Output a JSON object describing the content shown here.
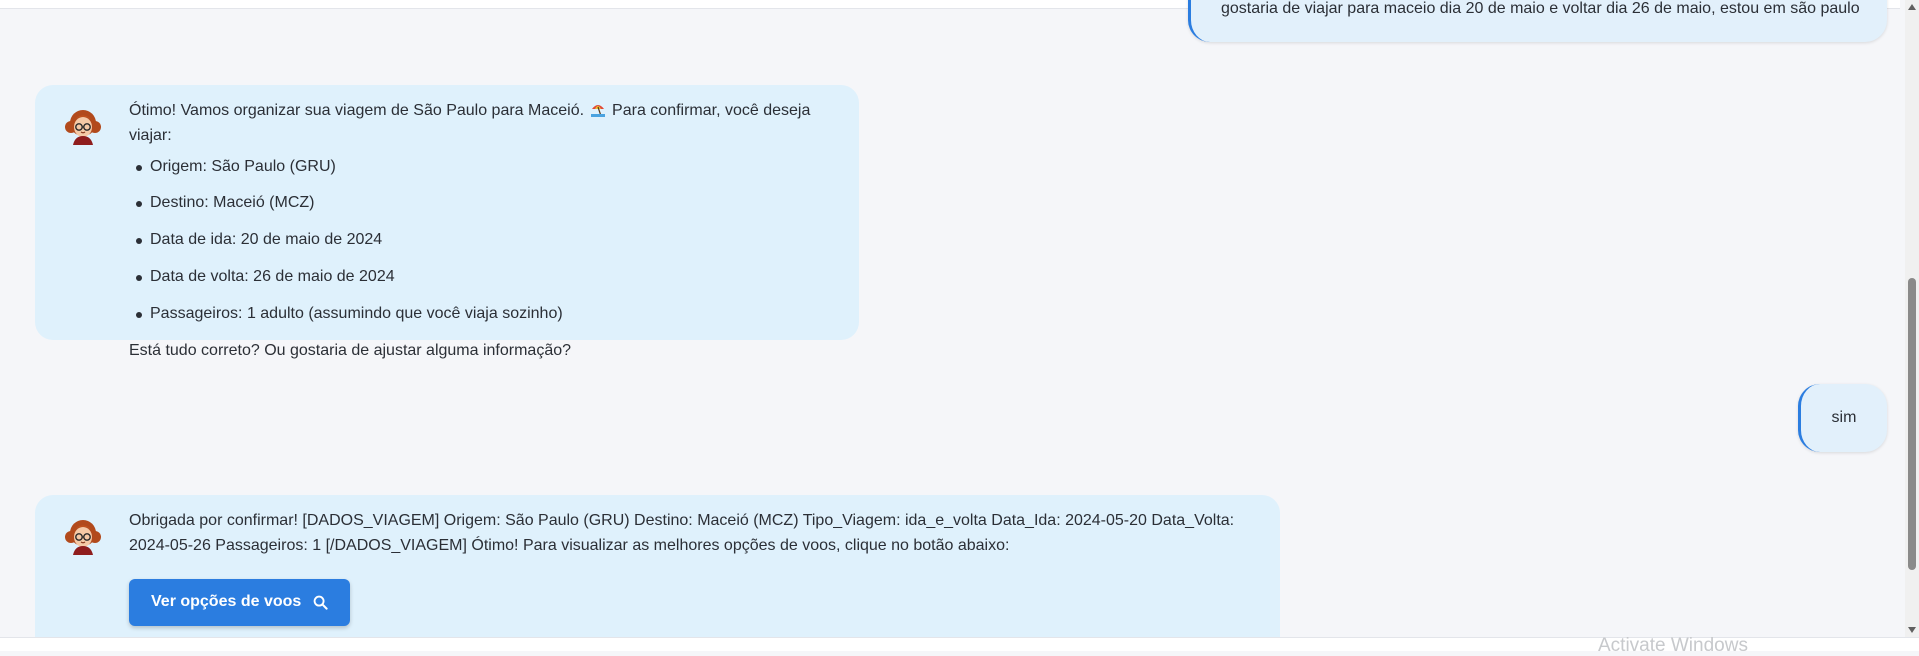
{
  "user_messages": {
    "first": "gostaria de viajar para maceio dia 20 de maio e voltar dia 26 de maio, estou em são paulo",
    "second": "sim"
  },
  "assistant_messages": {
    "first": {
      "intro_before_emoji": "Ótimo! Vamos organizar sua viagem de São Paulo para Maceió.",
      "intro_after_emoji": "Para confirmar, você deseja viajar:",
      "items": [
        "Origem: São Paulo (GRU)",
        "Destino: Maceió (MCZ)",
        "Data de ida: 20 de maio de 2024",
        "Data de volta: 26 de maio de 2024",
        "Passageiros: 1 adulto (assumindo que você viaja sozinho)"
      ],
      "closing": "Está tudo correto? Ou gostaria de ajustar alguma informação?"
    },
    "second": {
      "text": "Obrigada por confirmar! [DADOS_VIAGEM] Origem: São Paulo (GRU) Destino: Maceió (MCZ) Tipo_Viagem: ida_e_volta Data_Ida: 2024-05-20 Data_Volta: 2024-05-26 Passageiros: 1 [/DADOS_VIAGEM] Ótimo! Para visualizar as melhores opções de voos, clique no botão abaixo:",
      "button_label": "Ver opções de voos",
      "button_icon": "search-icon"
    }
  },
  "system": {
    "watermark": "Activate Windows"
  },
  "colors": {
    "background": "#f5f6f9",
    "assistant_bubble": "#dff1fc",
    "user_bubble": "#e2f0fb",
    "accent": "#2b7de0"
  }
}
